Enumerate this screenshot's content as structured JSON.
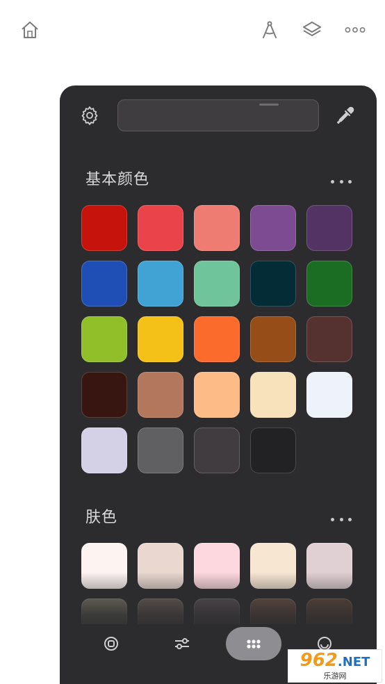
{
  "topbar": {
    "icons": [
      "home-icon",
      "compass-icon",
      "layers-icon",
      "more-icon"
    ]
  },
  "panel": {
    "sections": [
      {
        "title": "基本颜色",
        "swatches": [
          "#c6130c",
          "#ea444a",
          "#ee7c72",
          "#7d4b91",
          "#533363",
          "#1f4fb4",
          "#41a3d4",
          "#6fc49b",
          "#042c36",
          "#1c6d24",
          "#90bf2a",
          "#f4c118",
          "#fb6b2b",
          "#964d17",
          "#553130",
          "#371510",
          "#b2775c",
          "#fdbb88",
          "#f7e2bb",
          "#eef3fb",
          "#d4d1e6",
          "#606062",
          "#403c3f",
          "#222124"
        ]
      },
      {
        "title": "肤色",
        "swatches": [
          "#fdf4f2",
          "#e9d7d0",
          "#fdd8de",
          "#f7e6d2",
          "#e0d0d3",
          "#8e8a74",
          "#7d6e63",
          "#655a5f",
          "#7d5a49",
          "#6e4f3c"
        ]
      }
    ]
  },
  "bottom_bar": {
    "tabs": [
      "disc-icon",
      "sliders-icon",
      "grid-icon",
      "palette-icon"
    ],
    "active": 2
  },
  "watermark": {
    "main": "962",
    "suffix": ".NET",
    "sub": "乐游网"
  }
}
